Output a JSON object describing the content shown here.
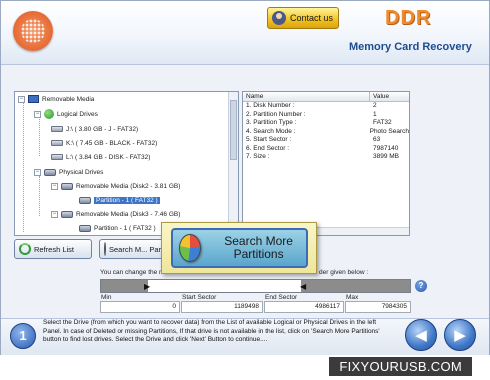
{
  "header": {
    "brand": "DDR",
    "title": "Memory Card Recovery",
    "contact_label": "Contact us",
    "logo_icon": "pinwheel-logo-icon"
  },
  "tree": {
    "items": [
      {
        "label": "Removable Media",
        "icon": "monitor-icon"
      },
      {
        "label": "Logical Drives",
        "icon": "globe-icon"
      },
      {
        "label": "J:\\ ( 3.80 GB - J - FAT32)",
        "icon": "drive-icon"
      },
      {
        "label": "K:\\ ( 7.45 GB - BLACK - FAT32)",
        "icon": "drive-icon"
      },
      {
        "label": "L:\\ ( 3.84 GB - DISK - FAT32)",
        "icon": "drive-icon"
      },
      {
        "label": "Physical Drives",
        "icon": "disk-icon"
      },
      {
        "label": "Removable Media (Disk2 - 3.81 GB)",
        "icon": "disk-icon"
      },
      {
        "label": "Partition - 1 ( FAT32 )",
        "icon": "disk-icon",
        "selected": true
      },
      {
        "label": "Removable Media (Disk3 - 7.46 GB)",
        "icon": "disk-icon"
      },
      {
        "label": "Partition - 1 ( FAT32 )",
        "icon": "disk-icon"
      }
    ]
  },
  "info": {
    "col_name": "Name",
    "col_value": "Value",
    "rows": [
      {
        "name": "1. Disk Number :",
        "value": "2"
      },
      {
        "name": "2. Partition Number :",
        "value": "1"
      },
      {
        "name": "3. Partition Type :",
        "value": "FAT32"
      },
      {
        "name": "4. Search Mode :",
        "value": "Photo Search"
      },
      {
        "name": "5. Start Sector :",
        "value": "63"
      },
      {
        "name": "6. End Sector :",
        "value": "7987140"
      },
      {
        "name": "7. Size :",
        "value": "3899 MB"
      }
    ]
  },
  "buttons": {
    "refresh": "Refresh List",
    "search_partial": "Search M... Partition...",
    "search_more": "Search More Partitions"
  },
  "range": {
    "hint_left": "You can change the r",
    "hint_right": "der given below :",
    "min_label": "Min",
    "min_value": "0",
    "start_label": "Start Sector",
    "start_value": "1189498",
    "end_label": "End Sector",
    "end_value": "4986117",
    "max_label": "Max",
    "max_value": "7984305"
  },
  "footer": {
    "step": "1",
    "instructions": "Select the Drive (from which you want to recover data) from the List of available Logical or Physical Drives in the left Panel. In case of Deleted or missing Partitions, If that drive is not available in the list, click on 'Search More Partitions' button to find lost drives. Select the Drive and click 'Next' Button to continue....",
    "back_arrow": "◀",
    "next_arrow": "▶"
  },
  "watermark": "FIXYOURUSB.COM",
  "colors": {
    "accent": "#3b74c8",
    "brand": "#f08a2a",
    "title": "#1d4c8f",
    "popup": "#efe69a"
  }
}
